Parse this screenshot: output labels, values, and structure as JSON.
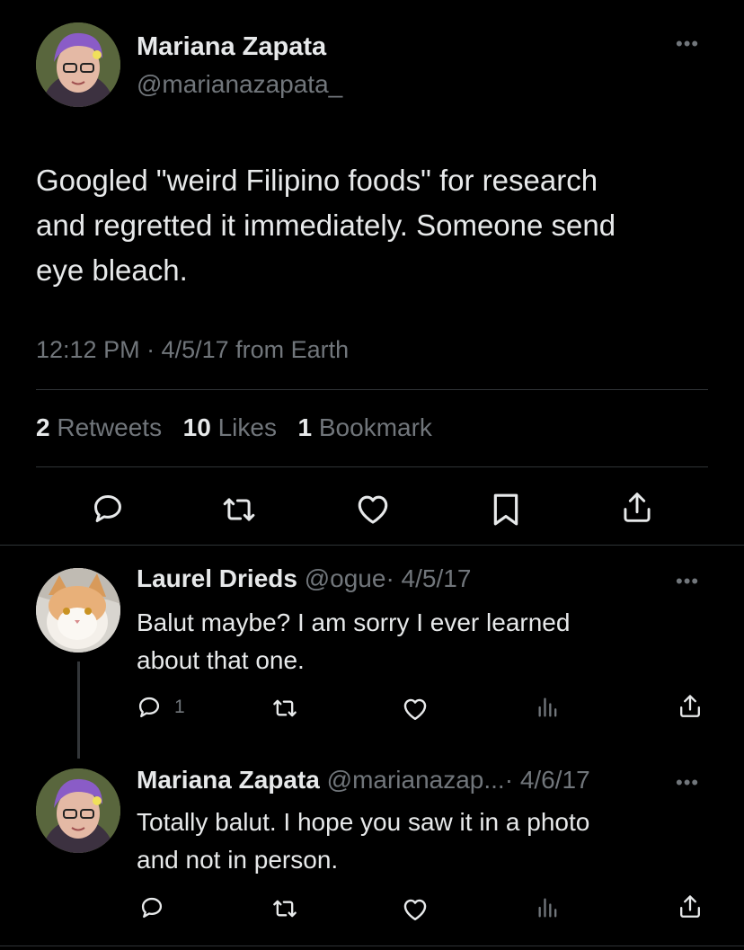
{
  "main_tweet": {
    "author_name": "Mariana Zapata",
    "author_handle": "@marianazapata_",
    "text_line1": "Googled \"weird Filipino foods\" for research",
    "text_line2": "and regretted it immediately. Someone send",
    "text_line3": "eye bleach.",
    "timestamp": "12:12 PM · 4/5/17 from Earth",
    "stats": {
      "retweets_count": "2",
      "retweets_label": "Retweets",
      "likes_count": "10",
      "likes_label": "Likes",
      "bookmarks_count": "1",
      "bookmarks_label": "Bookmark"
    },
    "actions": [
      "reply-icon",
      "retweet-icon",
      "like-icon",
      "bookmark-icon",
      "share-icon"
    ]
  },
  "replies": [
    {
      "author_name": "Laurel Drieds",
      "author_handle": "@ogue",
      "date": "· 4/5/17",
      "text_line1": "Balut maybe?  I am sorry I ever learned",
      "text_line2": "about that one.",
      "reply_count": "1"
    },
    {
      "author_name": "Mariana Zapata",
      "author_handle": "@marianazap...",
      "date": "· 4/6/17",
      "text_line1": "Totally balut. I hope you saw it in a photo",
      "text_line2": "and not in person.",
      "reply_count": ""
    }
  ],
  "colors": {
    "background": "#000000",
    "text": "#e7e9ea",
    "muted": "#71767b",
    "divider": "#2f3336"
  }
}
